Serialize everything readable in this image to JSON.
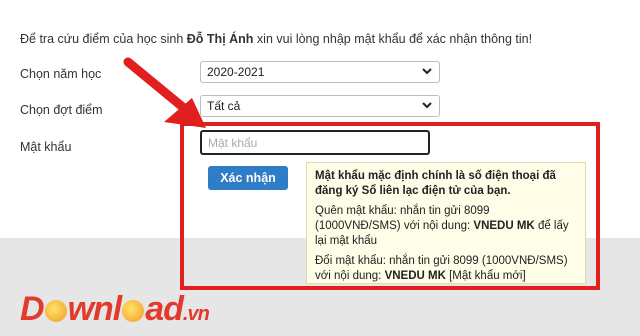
{
  "intro": {
    "prefix": "Để tra cứu điểm của học sinh ",
    "student_name": "Đỗ Thị Ánh",
    "suffix": " xin vui lòng nhập mật khẩu để xác nhận thông tin!"
  },
  "form": {
    "year_label": "Chọn năm học",
    "year_value": "2020-2021",
    "term_label": "Chọn đợt điểm",
    "term_value": "Tất cả",
    "password_label": "Mật khẩu",
    "password_placeholder": "Mật khẩu",
    "password_value": "",
    "submit_label": "Xác nhận"
  },
  "tooltip": {
    "line1": "Mật khẩu mặc định chính là số điện thoại đã đăng ký Sổ liên lạc điện tử của bạn.",
    "forgot_text": "Quên mật khẩu: nhắn tin gửi 8099 (1000VNĐ/SMS) với nội dung:",
    "forgot_code": "VNEDU MK",
    "forgot_suffix": " để lấy lại mật khẩu",
    "change_text": "Đổi mật khẩu: nhắn tin gửi 8099 (1000VNĐ/SMS) với nội dung:",
    "change_code": "VNEDU MK",
    "change_suffix": " [Mật khẩu mới]"
  },
  "watermark": {
    "brand_a": "D",
    "brand_b": "wnl",
    "brand_c": "ad",
    "tld": ".vn"
  },
  "colors": {
    "button": "#2e7dc6",
    "highlight": "#e11f1f",
    "tooltip_bg": "#fffde7"
  },
  "icons": {
    "select_chevron": "chevron-down-icon",
    "annotation_arrow": "red-arrow-icon"
  }
}
